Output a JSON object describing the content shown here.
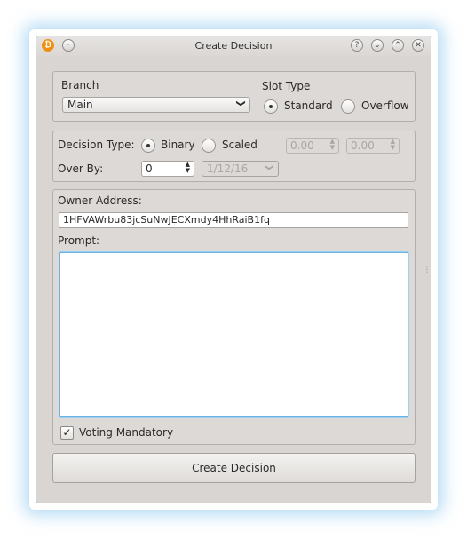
{
  "window": {
    "title": "Create Decision",
    "app_icon": "bitcoin-icon",
    "title_buttons": [
      "help-icon",
      "minimize-icon",
      "maximize-icon",
      "close-icon"
    ]
  },
  "branch": {
    "label": "Branch",
    "selected": "Main"
  },
  "slot_type": {
    "label": "Slot Type",
    "options": [
      "Standard",
      "Overflow"
    ],
    "selected": "Standard"
  },
  "decision_type": {
    "label": "Decision Type:",
    "options": [
      "Binary",
      "Scaled"
    ],
    "selected": "Binary",
    "scaled_min": "0.00",
    "scaled_max": "0.00"
  },
  "over_by": {
    "label": "Over By:",
    "value": "0",
    "date": "1/12/16"
  },
  "owner": {
    "label": "Owner Address:",
    "value": "1HFVAWrbu83jcSuNwJECXmdy4HhRaiB1fq"
  },
  "prompt": {
    "label": "Prompt:",
    "value": ""
  },
  "voting_mandatory": {
    "label": "Voting Mandatory",
    "checked": true
  },
  "submit": {
    "label": "Create Decision"
  }
}
